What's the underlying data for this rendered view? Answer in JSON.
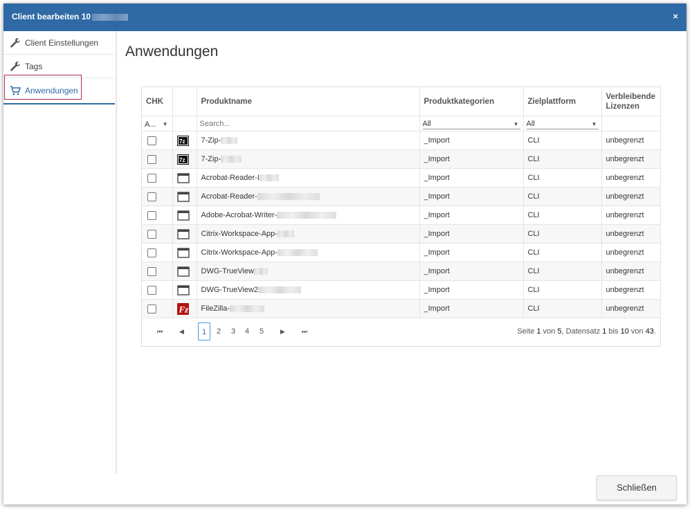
{
  "dialog": {
    "title": "Client bearbeiten 10",
    "close": "×"
  },
  "sidebar": {
    "items": [
      {
        "label": "Client Einstellungen",
        "icon": "wrench-icon"
      },
      {
        "label": "Tags",
        "icon": "wrench-icon"
      },
      {
        "label": "Anwendungen",
        "icon": "cart-icon"
      }
    ]
  },
  "main": {
    "heading": "Anwendungen"
  },
  "grid": {
    "columns": [
      "CHK",
      "",
      "Produktname",
      "Produktkategorien",
      "Zielplattform",
      "Verbleibende Lizenzen"
    ],
    "filter": {
      "chk": "A...",
      "search_placeholder": "Search...",
      "kategorie": "All",
      "plattform": "All"
    },
    "rows": [
      {
        "icon": "7zip-icon",
        "name": "7-Zip-",
        "kategorie": "_Import",
        "plattform": "CLI",
        "lizenzen": "unbegrenzt"
      },
      {
        "icon": "7zip-icon",
        "name": "7-Zip-",
        "kategorie": "_Import",
        "plattform": "CLI",
        "lizenzen": "unbegrenzt"
      },
      {
        "icon": "window-icon",
        "name": "Acrobat-Reader-I",
        "kategorie": "_Import",
        "plattform": "CLI",
        "lizenzen": "unbegrenzt"
      },
      {
        "icon": "window-icon",
        "name": "Acrobat-Reader-",
        "kategorie": "_Import",
        "plattform": "CLI",
        "lizenzen": "unbegrenzt"
      },
      {
        "icon": "window-icon",
        "name": "Adobe-Acrobat-Writer-",
        "kategorie": "_Import",
        "plattform": "CLI",
        "lizenzen": "unbegrenzt"
      },
      {
        "icon": "window-icon",
        "name": "Citrix-Workspace-App-",
        "kategorie": "_Import",
        "plattform": "CLI",
        "lizenzen": "unbegrenzt"
      },
      {
        "icon": "window-icon",
        "name": "Citrix-Workspace-App-",
        "kategorie": "_Import",
        "plattform": "CLI",
        "lizenzen": "unbegrenzt"
      },
      {
        "icon": "window-icon",
        "name": "DWG-TrueView",
        "kategorie": "_Import",
        "plattform": "CLI",
        "lizenzen": "unbegrenzt"
      },
      {
        "icon": "window-icon",
        "name": "DWG-TrueView2",
        "kategorie": "_Import",
        "plattform": "CLI",
        "lizenzen": "unbegrenzt"
      },
      {
        "icon": "filezilla-icon",
        "name": "FileZilla-",
        "kategorie": "_Import",
        "plattform": "CLI",
        "lizenzen": "unbegrenzt"
      }
    ]
  },
  "pager": {
    "first": "⏮",
    "prev": "◀",
    "next": "▶",
    "last": "⏭",
    "pages": [
      "1",
      "2",
      "3",
      "4",
      "5"
    ],
    "current": "1",
    "info": {
      "p1": "Seite ",
      "page": "1",
      "p2": " von ",
      "pages": "5",
      "p3": ", Datensatz ",
      "from": "1",
      "p4": " bis ",
      "to": "10",
      "p5": " von ",
      "total": "43",
      "p6": "."
    }
  },
  "footer": {
    "close_label": "Schließen"
  },
  "colors": {
    "titlebar": "#2f6aa6",
    "active_outline": "#b0274b",
    "accent": "#2f6aa6"
  }
}
